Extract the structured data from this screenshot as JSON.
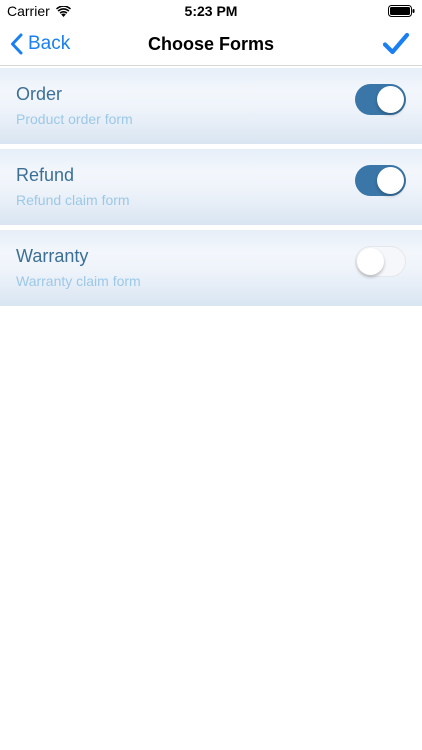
{
  "status_bar": {
    "carrier": "Carrier",
    "time": "5:23 PM"
  },
  "nav": {
    "back_label": "Back",
    "title": "Choose Forms"
  },
  "forms": [
    {
      "title": "Order",
      "subtitle": "Product order form",
      "enabled": true
    },
    {
      "title": "Refund",
      "subtitle": "Refund claim form",
      "enabled": true
    },
    {
      "title": "Warranty",
      "subtitle": "Warranty claim form",
      "enabled": false
    }
  ],
  "colors": {
    "accent": "#1a7ff0",
    "toggle_on": "#3a76a8",
    "title_text": "#3c6f96",
    "subtitle_text": "#9cc8e8"
  }
}
